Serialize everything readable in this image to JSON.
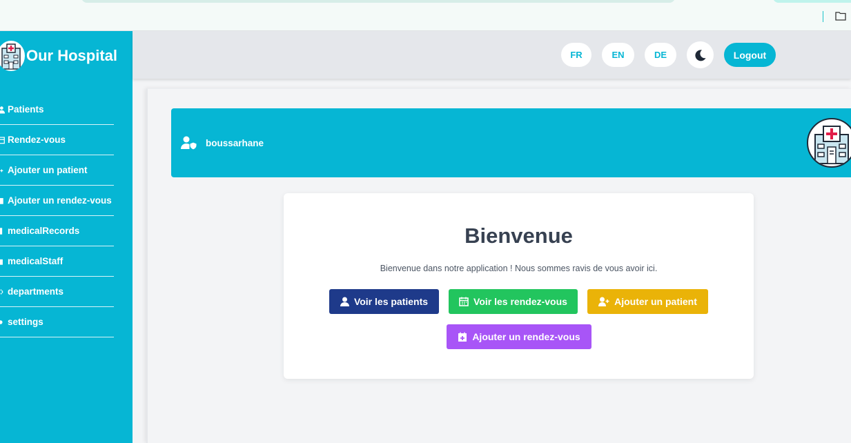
{
  "app": {
    "title": "Our Hospital",
    "colors": {
      "primary": "#06b6d4",
      "header_bg": "#e5e7eb",
      "page_bg": "#f3f4f6",
      "btn_patients": "#1e3a8a",
      "btn_rdv": "#22c55e",
      "btn_add_patient": "#eab308",
      "btn_add_rdv": "#a855f7"
    }
  },
  "sidebar": {
    "items": [
      {
        "label": "Patients",
        "icon": "user-icon"
      },
      {
        "label": "Rendez-vous",
        "icon": "calendar-icon"
      },
      {
        "label": "Ajouter un patient",
        "icon": "plus-icon"
      },
      {
        "label": "Ajouter un rendez-vous",
        "icon": "calendar-plus-icon"
      },
      {
        "label": "medicalRecords",
        "icon": "file-icon"
      },
      {
        "label": "medicalStaff",
        "icon": "briefcase-icon"
      },
      {
        "label": "departments",
        "icon": "gear-icon"
      },
      {
        "label": "settings",
        "icon": "cog-icon"
      }
    ]
  },
  "header": {
    "languages": [
      "FR",
      "EN",
      "DE"
    ],
    "theme_icon": "moon-icon",
    "logout_label": "Logout"
  },
  "user": {
    "name": "boussarhane",
    "icon": "user-shield-icon"
  },
  "welcome": {
    "title": "Bienvenue",
    "message": "Bienvenue dans notre application ! Nous sommes ravis de vous avoir ici.",
    "buttons": {
      "view_patients": "Voir les patients",
      "view_appointments": "Voir les rendez-vous",
      "add_patient": "Ajouter un patient",
      "add_appointment": "Ajouter un rendez-vous"
    }
  }
}
